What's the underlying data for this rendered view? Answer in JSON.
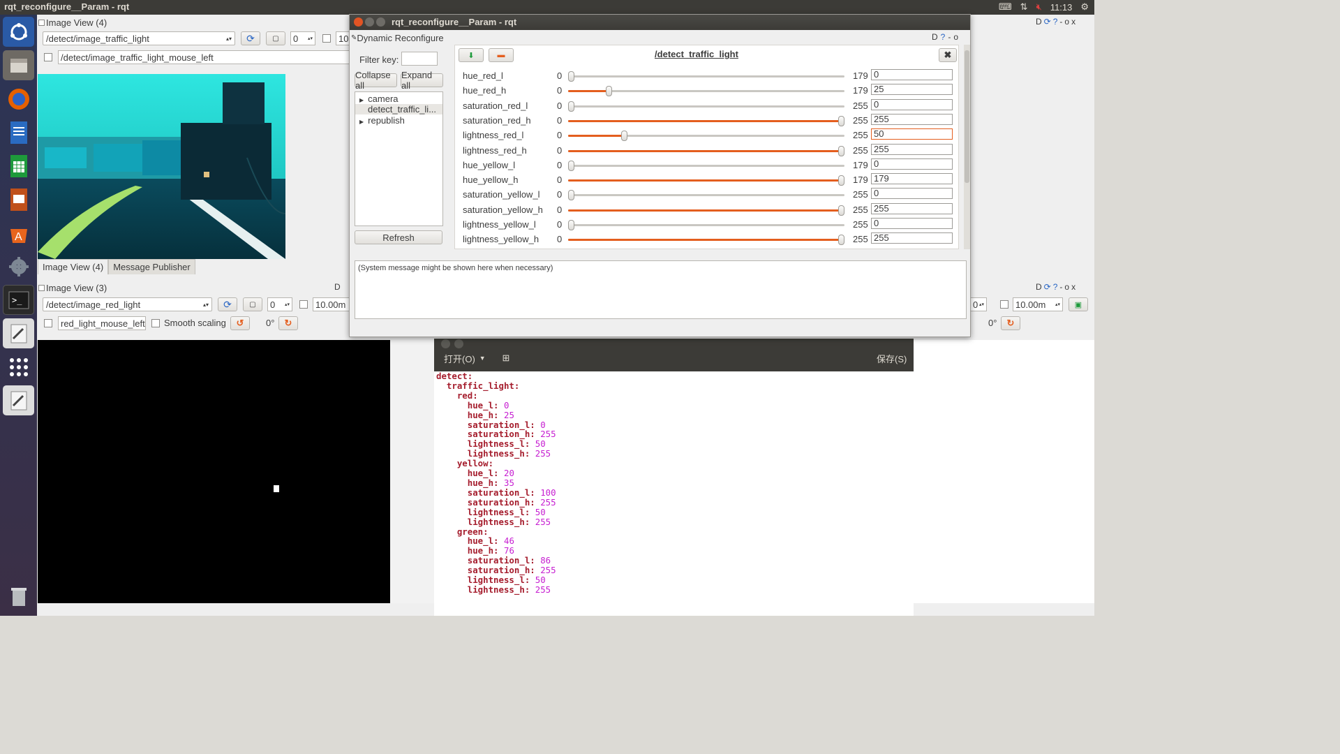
{
  "topbar": {
    "title": "rqt_reconfigure__Param - rqt",
    "time": "11:13"
  },
  "view4": {
    "title": "Image View (4)",
    "topic": "/detect/image_traffic_light",
    "spin_value": "0",
    "partial_value": "10",
    "mouse_topic": "/detect/image_traffic_light_mouse_left"
  },
  "tabs": [
    "Image View (4)",
    "Message Publisher"
  ],
  "view3": {
    "title": "Image View (3)",
    "topic": "/detect/image_red_light",
    "spin_value": "0",
    "zoom": "10.00m",
    "mouse_topic": "red_light_mouse_left",
    "smooth_label": "Smooth scaling",
    "rotation": "0°"
  },
  "right_view": {
    "spin_value": "0",
    "zoom": "10.00m",
    "rotation": "0°"
  },
  "recfg": {
    "window_title": "rqt_reconfigure__Param - rqt",
    "plugin_title": "Dynamic Reconfigure",
    "filter_label": "Filter key:",
    "filter_value": "",
    "collapse_label": "Collapse all",
    "expand_label": "Expand all",
    "tree": [
      "camera",
      "detect_traffic_li...",
      "republish"
    ],
    "refresh_label": "Refresh",
    "node_title": "/detect_traffic_light",
    "system_message": "(System message might be shown here when necessary)",
    "params": [
      {
        "name": "hue_red_l",
        "min": "0",
        "max": "179",
        "value": "0",
        "level": 0.0
      },
      {
        "name": "hue_red_h",
        "min": "0",
        "max": "179",
        "value": "25",
        "level": 0.14
      },
      {
        "name": "saturation_red_l",
        "min": "0",
        "max": "255",
        "value": "0",
        "level": 0.0
      },
      {
        "name": "saturation_red_h",
        "min": "0",
        "max": "255",
        "value": "255",
        "level": 1.0
      },
      {
        "name": "lightness_red_l",
        "min": "0",
        "max": "255",
        "value": "50",
        "level": 0.196,
        "focused": true
      },
      {
        "name": "lightness_red_h",
        "min": "0",
        "max": "255",
        "value": "255",
        "level": 1.0
      },
      {
        "name": "hue_yellow_l",
        "min": "0",
        "max": "179",
        "value": "0",
        "level": 0.0
      },
      {
        "name": "hue_yellow_h",
        "min": "0",
        "max": "179",
        "value": "179",
        "level": 1.0
      },
      {
        "name": "saturation_yellow_l",
        "min": "0",
        "max": "255",
        "value": "0",
        "level": 0.0
      },
      {
        "name": "saturation_yellow_h",
        "min": "0",
        "max": "255",
        "value": "255",
        "level": 1.0
      },
      {
        "name": "lightness_yellow_l",
        "min": "0",
        "max": "255",
        "value": "0",
        "level": 0.0
      },
      {
        "name": "lightness_yellow_h",
        "min": "0",
        "max": "255",
        "value": "255",
        "level": 1.0
      }
    ]
  },
  "editor": {
    "open_label": "打开(O)",
    "save_label": "保存(S)",
    "code": [
      {
        "key": "detect:",
        "val": ""
      },
      {
        "key": "  traffic_light:",
        "val": ""
      },
      {
        "key": "    red:",
        "val": ""
      },
      {
        "key": "      hue_l: ",
        "val": "0"
      },
      {
        "key": "      hue_h: ",
        "val": "25"
      },
      {
        "key": "      saturation_l: ",
        "val": "0"
      },
      {
        "key": "      saturation_h: ",
        "val": "255"
      },
      {
        "key": "      lightness_l: ",
        "val": "50"
      },
      {
        "key": "      lightness_h: ",
        "val": "255"
      },
      {
        "key": "    yellow:",
        "val": ""
      },
      {
        "key": "      hue_l: ",
        "val": "20"
      },
      {
        "key": "      hue_h: ",
        "val": "35"
      },
      {
        "key": "      saturation_l: ",
        "val": "100"
      },
      {
        "key": "      saturation_h: ",
        "val": "255"
      },
      {
        "key": "      lightness_l: ",
        "val": "50"
      },
      {
        "key": "      lightness_h: ",
        "val": "255"
      },
      {
        "key": "    green:",
        "val": ""
      },
      {
        "key": "      hue_l: ",
        "val": "46"
      },
      {
        "key": "      hue_h: ",
        "val": "76"
      },
      {
        "key": "      saturation_l: ",
        "val": "86"
      },
      {
        "key": "      saturation_h: ",
        "val": "255"
      },
      {
        "key": "      lightness_l: ",
        "val": "50"
      },
      {
        "key": "      lightness_h: ",
        "val": "255"
      }
    ]
  },
  "colors": {
    "accent": "#e45e1e",
    "topbar": "#3c3b37",
    "launcher": "#2b3556"
  },
  "launcher_icons": [
    "ubuntu-dash-icon",
    "files-icon",
    "firefox-icon",
    "writer-icon",
    "calc-icon",
    "impress-icon",
    "software-center-icon",
    "settings-icon",
    "terminal-icon",
    "text-editor-icon",
    "app-grid-icon",
    "text-editor-2-icon",
    "trash-icon"
  ]
}
